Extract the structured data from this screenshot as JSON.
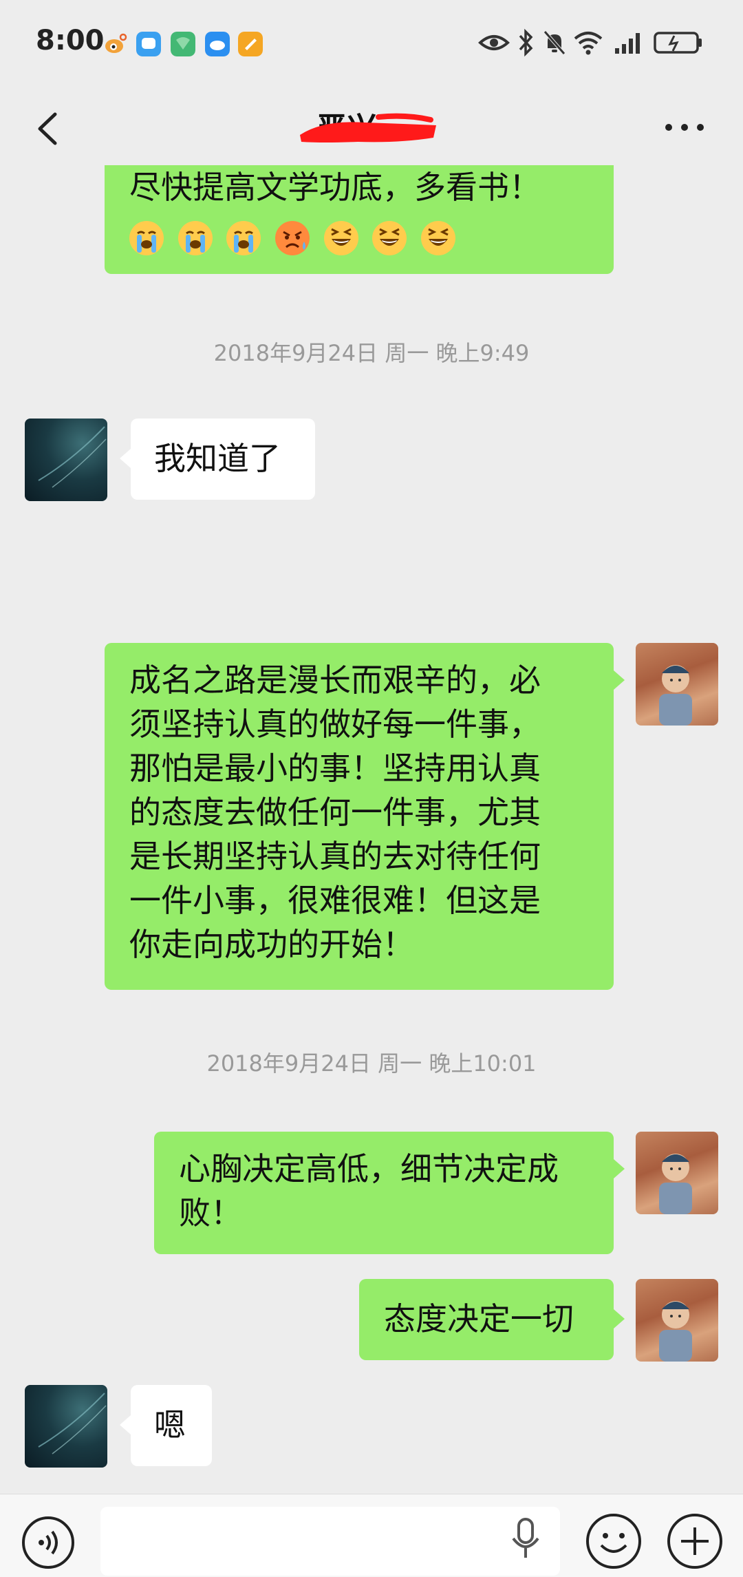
{
  "status_bar": {
    "time": "8:00"
  },
  "header": {
    "title": "严兴"
  },
  "messages": [
    {
      "type": "sent",
      "text": "尽快提高文学功底，多看书！",
      "emojis": [
        "loudly-crying-face",
        "loudly-crying-face",
        "loudly-crying-face",
        "angry-sweat-face",
        "laughing-face",
        "laughing-face",
        "laughing-face"
      ]
    },
    {
      "type": "timestamp",
      "text": "2018年9月24日 周一 晚上9:49"
    },
    {
      "type": "received",
      "text": "我知道了"
    },
    {
      "type": "sent",
      "text": "成名之路是漫长而艰辛的，必\n须坚持认真的做好每一件事，\n那怕是最小的事！坚持用认真\n的态度去做任何一件事，尤其\n是长期坚持认真的去对待任何\n一件小事，很难很难！但这是\n你走向成功的开始！"
    },
    {
      "type": "timestamp",
      "text": "2018年9月24日 周一 晚上10:01"
    },
    {
      "type": "sent",
      "text": "心胸决定高低，细节决定成\n败！"
    },
    {
      "type": "sent",
      "text": "态度决定一切"
    },
    {
      "type": "received",
      "text": "嗯"
    }
  ],
  "icons": {
    "back": "back-arrow-icon",
    "more": "more-dots-icon",
    "voice": "voice-icon",
    "mic": "microphone-icon",
    "emoji": "emoji-icon",
    "plus": "plus-icon"
  },
  "colors": {
    "background": "#ededed",
    "sent_bubble": "#95ec69",
    "received_bubble": "#ffffff",
    "timestamp": "#999999",
    "redaction": "#ff1a1a"
  }
}
